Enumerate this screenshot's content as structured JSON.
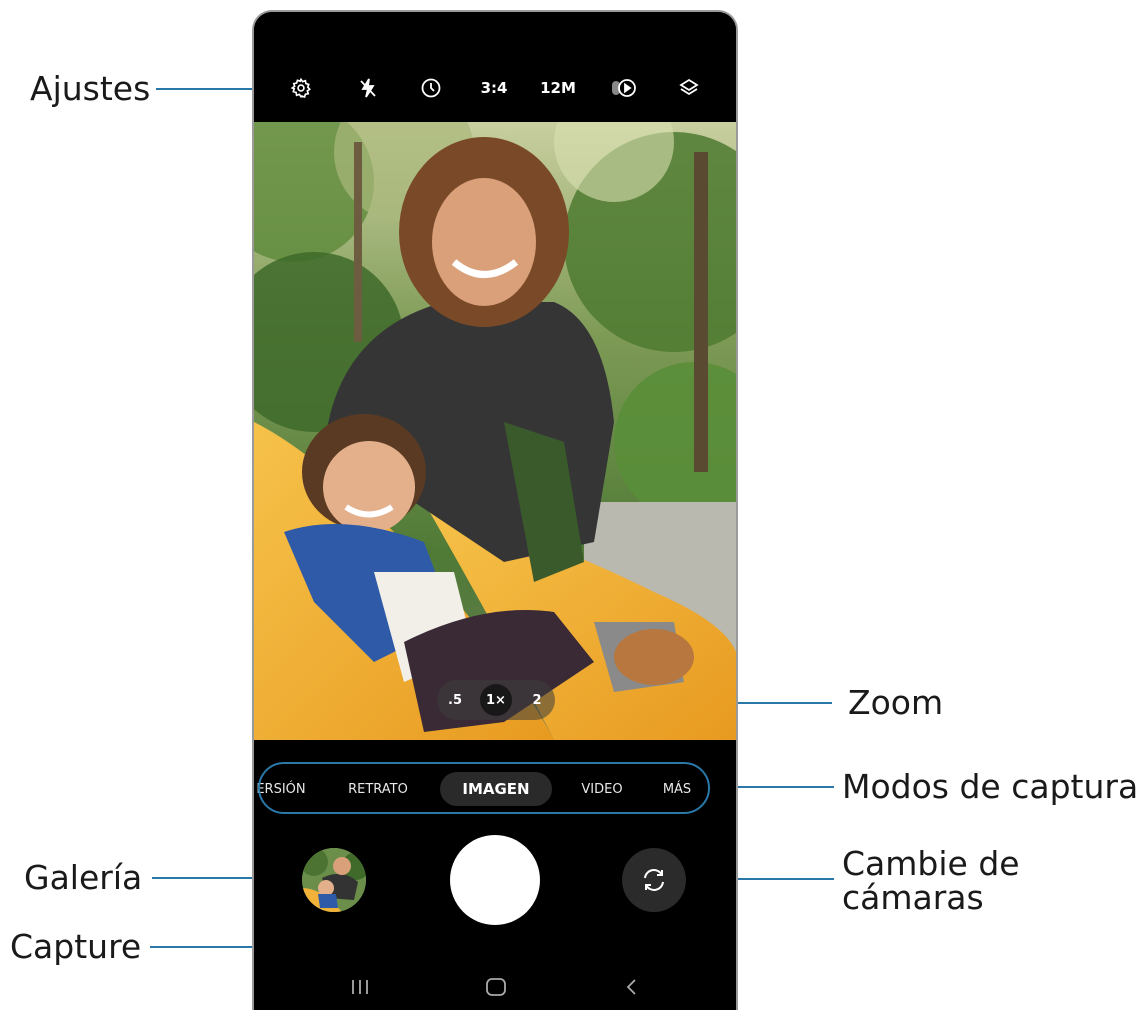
{
  "callouts": {
    "settings": "Ajustes",
    "zoom": "Zoom",
    "shooting_modes": "Modos de captura",
    "switch_cameras_line1": "Cambie de",
    "switch_cameras_line2": "cámaras",
    "gallery": "Galería",
    "capture": "Capture"
  },
  "top_bar": {
    "settings_icon": "gear-icon",
    "flash_icon": "flash-off-icon",
    "timer_icon": "timer-icon",
    "ratio_label": "3:4",
    "resolution_label": "12M",
    "motion_photo_icon": "motion-photo-icon",
    "filters_icon": "layers-icon"
  },
  "zoom": {
    "options": [
      ".5",
      "1×",
      "2"
    ],
    "selected": "1×"
  },
  "modes": {
    "items": [
      "ERSIÓN",
      "RETRATO",
      "IMAGEN",
      "VIDEO",
      "MÁS"
    ],
    "selected": "IMAGEN"
  },
  "controls": {
    "gallery_icon": "gallery-thumbnail",
    "shutter_icon": "shutter-button",
    "switch_icon": "camera-switch-icon"
  },
  "navbar": {
    "recents_icon": "recents-icon",
    "home_icon": "home-icon",
    "back_icon": "back-icon"
  },
  "colors": {
    "leader_line": "#2a78a8",
    "phone_bg": "#000000",
    "slide": "#f2b23a"
  }
}
